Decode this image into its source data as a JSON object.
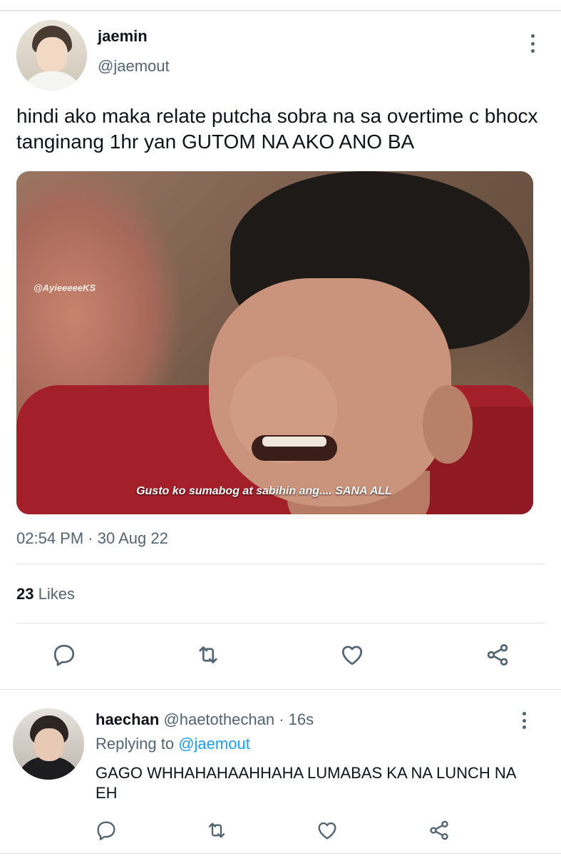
{
  "tweet": {
    "author": {
      "name": "jaemin",
      "handle": "@jaemout"
    },
    "text": "hindi ako maka relate putcha sobra na sa overtime c bhocx tanginang 1hr yan GUTOM NA AKO ANO BA",
    "media": {
      "watermark": "@AyieeeeeKS",
      "caption": "Gusto ko sumabog at sabihin ang.... SANA ALL"
    },
    "timestamp": "02:54 PM · 30 Aug 22",
    "likes": {
      "count": "23",
      "label": "Likes"
    },
    "actions": [
      "reply-icon",
      "retweet-icon",
      "like-icon",
      "share-icon"
    ]
  },
  "reply": {
    "author": {
      "name": "haechan",
      "handle": "@haetothechan"
    },
    "separator": " · ",
    "time": "16s",
    "replying_prefix": "Replying to",
    "replying_to": "@jaemout",
    "text": "GAGO WHHAHAHAAHHAHA LUMABAS KA NA LUNCH NA EH",
    "actions": [
      "reply-icon",
      "retweet-icon",
      "like-icon",
      "share-icon"
    ]
  },
  "colors": {
    "text": "#0f1419",
    "muted": "#536471",
    "link": "#1d9bf0",
    "divider": "#dfe3e6"
  }
}
